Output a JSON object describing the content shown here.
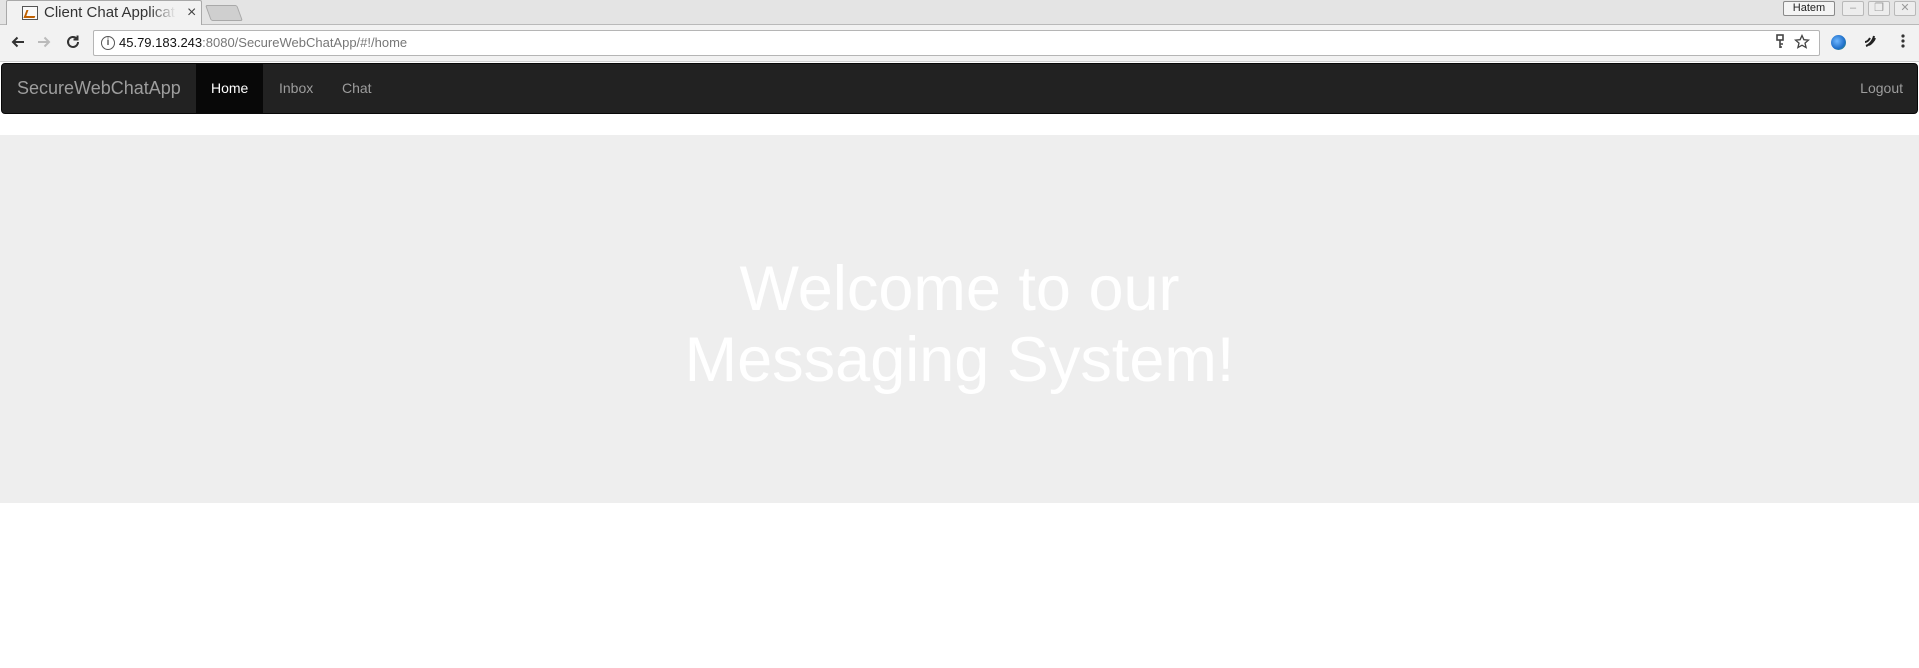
{
  "browser": {
    "tab": {
      "title": "Client Chat Application",
      "close_glyph": "×"
    },
    "profile_name": "Hatem",
    "window_buttons": {
      "minimize": "–",
      "restore": "❐",
      "close": "✕"
    },
    "address": {
      "host": "45.79.183.243",
      "rest": ":8080/SecureWebChatApp/#!/home"
    },
    "icons": {
      "back": "arrow-left-icon",
      "forward": "arrow-right-icon",
      "reload": "reload-icon",
      "info": "info-icon",
      "key": "key-icon",
      "bookmark": "star-icon",
      "extension_globe": "globe-icon",
      "extension_2": "extension-icon",
      "menu": "kebab-menu-icon"
    }
  },
  "navbar": {
    "brand": "SecureWebChatApp",
    "items": [
      {
        "label": "Home",
        "active": true
      },
      {
        "label": "Inbox",
        "active": false
      },
      {
        "label": "Chat",
        "active": false
      }
    ],
    "logout": "Logout"
  },
  "hero": {
    "title_line1": "Welcome to our",
    "title_line2": "Messaging System!"
  },
  "colors": {
    "navbar_bg": "#222222",
    "navbar_active_bg": "#080808",
    "nav_text": "#9d9d9d",
    "jumbotron_bg": "#eeeeee",
    "hero_text": "#ffffff"
  }
}
